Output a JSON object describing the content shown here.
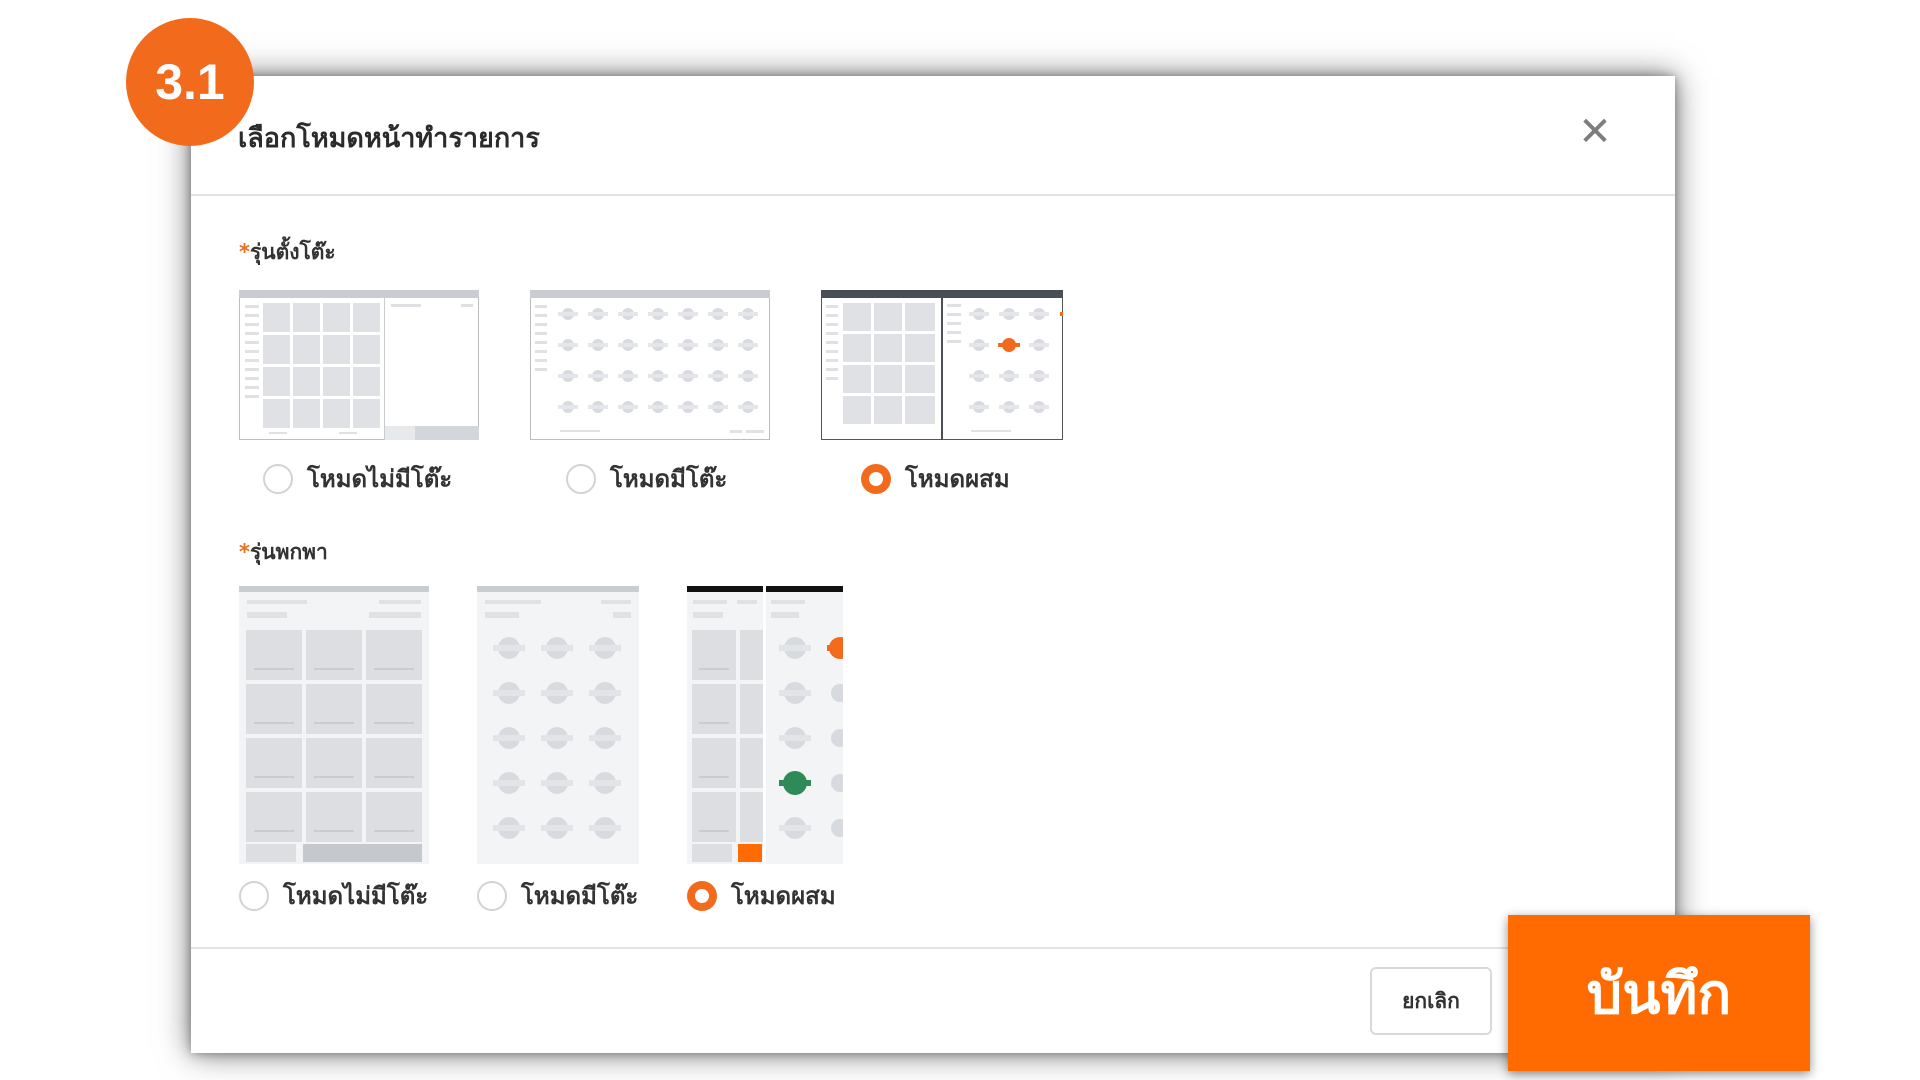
{
  "step_badge": "3.1",
  "dialog": {
    "title": "เลือกโหมดหน้าทำรายการ",
    "close_icon": "close-icon"
  },
  "sections": {
    "desktop": {
      "asterisk": "*",
      "label": "รุ่นตั้งโต๊ะ",
      "options": [
        {
          "label": "โหมดไม่มีโต๊ะ",
          "selected": false
        },
        {
          "label": "โหมดมีโต๊ะ",
          "selected": false
        },
        {
          "label": "โหมดผสม",
          "selected": true
        }
      ]
    },
    "mobile": {
      "asterisk": "*",
      "label": "รุ่นพกพา",
      "options": [
        {
          "label": "โหมดไม่มีโต๊ะ",
          "selected": false
        },
        {
          "label": "โหมดมีโต๊ะ",
          "selected": false
        },
        {
          "label": "โหมดผสม",
          "selected": true
        }
      ]
    }
  },
  "footer": {
    "cancel_label": "ยกเลิก",
    "save_label": "บันทึก"
  },
  "colors": {
    "accent": "#f26b1d",
    "save": "#ff6b00",
    "table_active": "#f26b1d",
    "table_green": "#2e8b57"
  }
}
